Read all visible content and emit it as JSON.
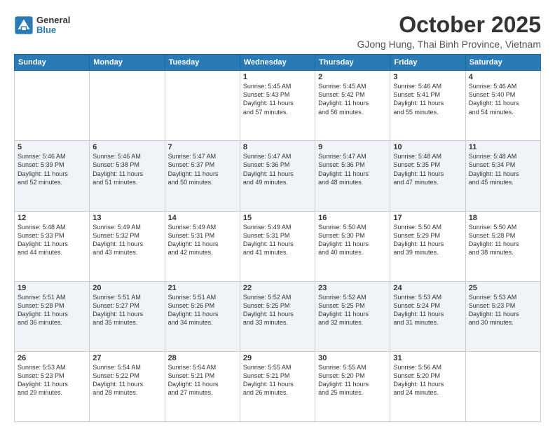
{
  "logo": {
    "general": "General",
    "blue": "Blue"
  },
  "header": {
    "month_year": "October 2025",
    "location": "GJong Hung, Thai Binh Province, Vietnam"
  },
  "weekdays": [
    "Sunday",
    "Monday",
    "Tuesday",
    "Wednesday",
    "Thursday",
    "Friday",
    "Saturday"
  ],
  "weeks": [
    [
      {
        "day": "",
        "info": ""
      },
      {
        "day": "",
        "info": ""
      },
      {
        "day": "",
        "info": ""
      },
      {
        "day": "1",
        "info": "Sunrise: 5:45 AM\nSunset: 5:43 PM\nDaylight: 11 hours\nand 57 minutes."
      },
      {
        "day": "2",
        "info": "Sunrise: 5:45 AM\nSunset: 5:42 PM\nDaylight: 11 hours\nand 56 minutes."
      },
      {
        "day": "3",
        "info": "Sunrise: 5:46 AM\nSunset: 5:41 PM\nDaylight: 11 hours\nand 55 minutes."
      },
      {
        "day": "4",
        "info": "Sunrise: 5:46 AM\nSunset: 5:40 PM\nDaylight: 11 hours\nand 54 minutes."
      }
    ],
    [
      {
        "day": "5",
        "info": "Sunrise: 5:46 AM\nSunset: 5:39 PM\nDaylight: 11 hours\nand 52 minutes."
      },
      {
        "day": "6",
        "info": "Sunrise: 5:46 AM\nSunset: 5:38 PM\nDaylight: 11 hours\nand 51 minutes."
      },
      {
        "day": "7",
        "info": "Sunrise: 5:47 AM\nSunset: 5:37 PM\nDaylight: 11 hours\nand 50 minutes."
      },
      {
        "day": "8",
        "info": "Sunrise: 5:47 AM\nSunset: 5:36 PM\nDaylight: 11 hours\nand 49 minutes."
      },
      {
        "day": "9",
        "info": "Sunrise: 5:47 AM\nSunset: 5:36 PM\nDaylight: 11 hours\nand 48 minutes."
      },
      {
        "day": "10",
        "info": "Sunrise: 5:48 AM\nSunset: 5:35 PM\nDaylight: 11 hours\nand 47 minutes."
      },
      {
        "day": "11",
        "info": "Sunrise: 5:48 AM\nSunset: 5:34 PM\nDaylight: 11 hours\nand 45 minutes."
      }
    ],
    [
      {
        "day": "12",
        "info": "Sunrise: 5:48 AM\nSunset: 5:33 PM\nDaylight: 11 hours\nand 44 minutes."
      },
      {
        "day": "13",
        "info": "Sunrise: 5:49 AM\nSunset: 5:32 PM\nDaylight: 11 hours\nand 43 minutes."
      },
      {
        "day": "14",
        "info": "Sunrise: 5:49 AM\nSunset: 5:31 PM\nDaylight: 11 hours\nand 42 minutes."
      },
      {
        "day": "15",
        "info": "Sunrise: 5:49 AM\nSunset: 5:31 PM\nDaylight: 11 hours\nand 41 minutes."
      },
      {
        "day": "16",
        "info": "Sunrise: 5:50 AM\nSunset: 5:30 PM\nDaylight: 11 hours\nand 40 minutes."
      },
      {
        "day": "17",
        "info": "Sunrise: 5:50 AM\nSunset: 5:29 PM\nDaylight: 11 hours\nand 39 minutes."
      },
      {
        "day": "18",
        "info": "Sunrise: 5:50 AM\nSunset: 5:28 PM\nDaylight: 11 hours\nand 38 minutes."
      }
    ],
    [
      {
        "day": "19",
        "info": "Sunrise: 5:51 AM\nSunset: 5:28 PM\nDaylight: 11 hours\nand 36 minutes."
      },
      {
        "day": "20",
        "info": "Sunrise: 5:51 AM\nSunset: 5:27 PM\nDaylight: 11 hours\nand 35 minutes."
      },
      {
        "day": "21",
        "info": "Sunrise: 5:51 AM\nSunset: 5:26 PM\nDaylight: 11 hours\nand 34 minutes."
      },
      {
        "day": "22",
        "info": "Sunrise: 5:52 AM\nSunset: 5:25 PM\nDaylight: 11 hours\nand 33 minutes."
      },
      {
        "day": "23",
        "info": "Sunrise: 5:52 AM\nSunset: 5:25 PM\nDaylight: 11 hours\nand 32 minutes."
      },
      {
        "day": "24",
        "info": "Sunrise: 5:53 AM\nSunset: 5:24 PM\nDaylight: 11 hours\nand 31 minutes."
      },
      {
        "day": "25",
        "info": "Sunrise: 5:53 AM\nSunset: 5:23 PM\nDaylight: 11 hours\nand 30 minutes."
      }
    ],
    [
      {
        "day": "26",
        "info": "Sunrise: 5:53 AM\nSunset: 5:23 PM\nDaylight: 11 hours\nand 29 minutes."
      },
      {
        "day": "27",
        "info": "Sunrise: 5:54 AM\nSunset: 5:22 PM\nDaylight: 11 hours\nand 28 minutes."
      },
      {
        "day": "28",
        "info": "Sunrise: 5:54 AM\nSunset: 5:21 PM\nDaylight: 11 hours\nand 27 minutes."
      },
      {
        "day": "29",
        "info": "Sunrise: 5:55 AM\nSunset: 5:21 PM\nDaylight: 11 hours\nand 26 minutes."
      },
      {
        "day": "30",
        "info": "Sunrise: 5:55 AM\nSunset: 5:20 PM\nDaylight: 11 hours\nand 25 minutes."
      },
      {
        "day": "31",
        "info": "Sunrise: 5:56 AM\nSunset: 5:20 PM\nDaylight: 11 hours\nand 24 minutes."
      },
      {
        "day": "",
        "info": ""
      }
    ]
  ]
}
